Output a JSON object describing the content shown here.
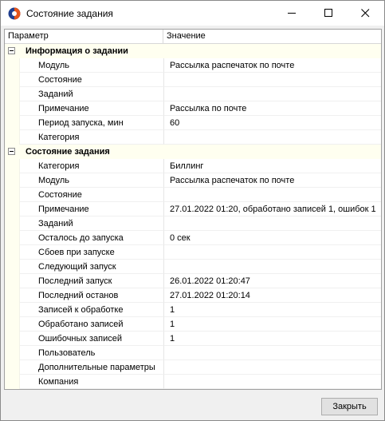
{
  "window": {
    "title": "Состояние задания",
    "icon": "app-logo-icon"
  },
  "controls": {
    "minimize_icon": "minimize-icon",
    "maximize_icon": "maximize-icon",
    "close_icon": "close-icon"
  },
  "grid": {
    "headers": {
      "param": "Параметр",
      "value": "Значение"
    },
    "groups": [
      {
        "title": "Информация о задании",
        "rows": [
          {
            "param": "Модуль",
            "value": "Рассылка распечаток по почте"
          },
          {
            "param": "Состояние",
            "value": ""
          },
          {
            "param": "Заданий",
            "value": ""
          },
          {
            "param": "Примечание",
            "value": "Рассылка по почте"
          },
          {
            "param": "Период запуска, мин",
            "value": "60"
          },
          {
            "param": "Категория",
            "value": ""
          }
        ]
      },
      {
        "title": "Состояние задания",
        "rows": [
          {
            "param": "Категория",
            "value": "Биллинг"
          },
          {
            "param": "Модуль",
            "value": "Рассылка распечаток по почте"
          },
          {
            "param": "Состояние",
            "value": ""
          },
          {
            "param": "Примечание",
            "value": " 27.01.2022 01:20, обработано записей 1, ошибок 1"
          },
          {
            "param": "Заданий",
            "value": ""
          },
          {
            "param": "Осталось до запуска",
            "value": "0 сек"
          },
          {
            "param": "Сбоев при запуске",
            "value": ""
          },
          {
            "param": "Следующий запуск",
            "value": ""
          },
          {
            "param": "Последний запуск",
            "value": "26.01.2022 01:20:47"
          },
          {
            "param": "Последний останов",
            "value": "27.01.2022 01:20:14"
          },
          {
            "param": "Записей к обработке",
            "value": "1"
          },
          {
            "param": "Обработано записей",
            "value": "1"
          },
          {
            "param": "Ошибочных записей",
            "value": "1"
          },
          {
            "param": "Пользователь",
            "value": ""
          },
          {
            "param": "Дополнительные параметры",
            "value": ""
          },
          {
            "param": "Компания",
            "value": ""
          }
        ]
      }
    ]
  },
  "footer": {
    "close_label": "Закрыть"
  }
}
